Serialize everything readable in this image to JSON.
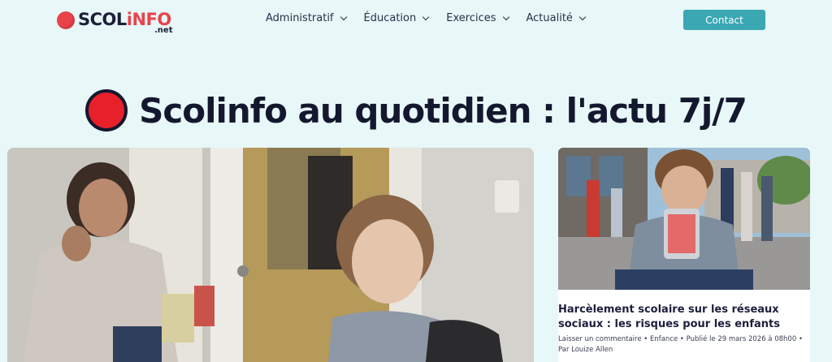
{
  "header": {
    "logo": {
      "text_main": "SCOL",
      "text_accent": "iNFO",
      "text_sub": ".net"
    },
    "nav": [
      {
        "label": "Administratif"
      },
      {
        "label": "Éducation"
      },
      {
        "label": "Exercices"
      },
      {
        "label": "Actualité"
      }
    ],
    "contact_label": "Contact"
  },
  "hero": {
    "title": "Scolinfo au quotidien : l'actu 7j/7"
  },
  "feature": {
    "image_icon": "photo-mother-child"
  },
  "card": {
    "image_icon": "photo-boy-phone",
    "title": "Harcèlement scolaire sur les réseaux sociaux : les risques pour les enfants",
    "meta": "Laisser un commentaire • Enfance • Publié le 29 mars 2026 à 08h00 • Par Louize Allen"
  },
  "colors": {
    "accent": "#3aa7b3",
    "brand_red": "#e8434a",
    "background": "#e8f7f7",
    "text": "#1b1f3b"
  }
}
